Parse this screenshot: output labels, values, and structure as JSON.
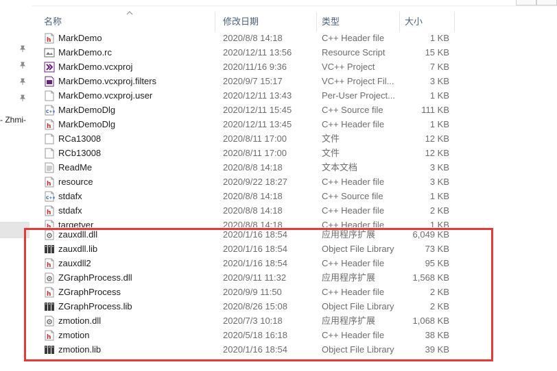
{
  "nav": {
    "truncated_label": "- Zhmi-"
  },
  "columns": {
    "name": "名称",
    "date": "修改日期",
    "type": "类型",
    "size": "大小"
  },
  "files": [
    {
      "name": "MarkDemo",
      "date": "2020/8/8 14:18",
      "type": "C++ Header file",
      "size": "1 KB",
      "icon": "h-file-icon"
    },
    {
      "name": "MarkDemo.rc",
      "date": "2020/12/11 13:56",
      "type": "Resource Script",
      "size": "15 KB",
      "icon": "rc-file-icon"
    },
    {
      "name": "MarkDemo.vcxproj",
      "date": "2020/11/16 9:36",
      "type": "VC++ Project",
      "size": "7 KB",
      "icon": "vcxproj-file-icon"
    },
    {
      "name": "MarkDemo.vcxproj.filters",
      "date": "2020/9/7 15:17",
      "type": "VC++ Project Fil...",
      "size": "3 KB",
      "icon": "filters-file-icon"
    },
    {
      "name": "MarkDemo.vcxproj.user",
      "date": "2020/12/11 13:43",
      "type": "Per-User Project...",
      "size": "1 KB",
      "icon": "user-file-icon"
    },
    {
      "name": "MarkDemoDlg",
      "date": "2020/12/11 15:45",
      "type": "C++ Source file",
      "size": "111 KB",
      "icon": "cpp-file-icon"
    },
    {
      "name": "MarkDemoDlg",
      "date": "2020/12/11 13:45",
      "type": "C++ Header file",
      "size": "1 KB",
      "icon": "h-file-icon"
    },
    {
      "name": "RCa13008",
      "date": "2020/8/11 17:00",
      "type": "文件",
      "size": "12 KB",
      "icon": "blank-file-icon"
    },
    {
      "name": "RCb13008",
      "date": "2020/8/11 17:00",
      "type": "文件",
      "size": "12 KB",
      "icon": "blank-file-icon"
    },
    {
      "name": "ReadMe",
      "date": "2020/8/8 14:18",
      "type": "文本文档",
      "size": "3 KB",
      "icon": "text-file-icon"
    },
    {
      "name": "resource",
      "date": "2020/9/22 18:27",
      "type": "C++ Header file",
      "size": "3 KB",
      "icon": "h-file-icon"
    },
    {
      "name": "stdafx",
      "date": "2020/8/8 14:18",
      "type": "C++ Source file",
      "size": "1 KB",
      "icon": "cpp-file-icon"
    },
    {
      "name": "stdafx",
      "date": "2020/8/8 14:18",
      "type": "C++ Header file",
      "size": "2 KB",
      "icon": "h-file-icon"
    },
    {
      "name": "targetver",
      "date": "2020/8/8 14:18",
      "type": "C++ Header file",
      "size": "1 KB",
      "icon": "h-file-icon",
      "clipped": true
    },
    {
      "name": "zauxdll.dll",
      "date": "2020/1/16 18:54",
      "type": "应用程序扩展",
      "size": "6,049 KB",
      "icon": "dll-file-icon"
    },
    {
      "name": "zauxdll.lib",
      "date": "2020/1/16 18:54",
      "type": "Object File Library",
      "size": "73 KB",
      "icon": "lib-file-icon"
    },
    {
      "name": "zauxdll2",
      "date": "2020/1/16 18:54",
      "type": "C++ Header file",
      "size": "95 KB",
      "icon": "h-file-icon"
    },
    {
      "name": "ZGraphProcess.dll",
      "date": "2020/9/11 11:32",
      "type": "应用程序扩展",
      "size": "1,568 KB",
      "icon": "dll-file-icon"
    },
    {
      "name": "ZGraphProcess",
      "date": "2020/9/9 11:50",
      "type": "C++ Header file",
      "size": "2 KB",
      "icon": "h-file-icon"
    },
    {
      "name": "ZGraphProcess.lib",
      "date": "2020/8/26 15:08",
      "type": "Object File Library",
      "size": "2 KB",
      "icon": "lib-file-icon"
    },
    {
      "name": "zmotion.dll",
      "date": "2020/7/3 10:18",
      "type": "应用程序扩展",
      "size": "1,068 KB",
      "icon": "dll-file-icon"
    },
    {
      "name": "zmotion",
      "date": "2020/5/18 16:18",
      "type": "C++ Header file",
      "size": "38 KB",
      "icon": "h-file-icon"
    },
    {
      "name": "zmotion.lib",
      "date": "2020/1/16 18:54",
      "type": "Object File Library",
      "size": "39 KB",
      "icon": "lib-file-icon"
    }
  ],
  "colors": {
    "highlight_border": "#e53935",
    "header_text": "#4c607a",
    "h_icon_red": "#c62828",
    "cpp_icon_blue": "#1e5fbf",
    "vcxproj_purple": "#68217a"
  }
}
